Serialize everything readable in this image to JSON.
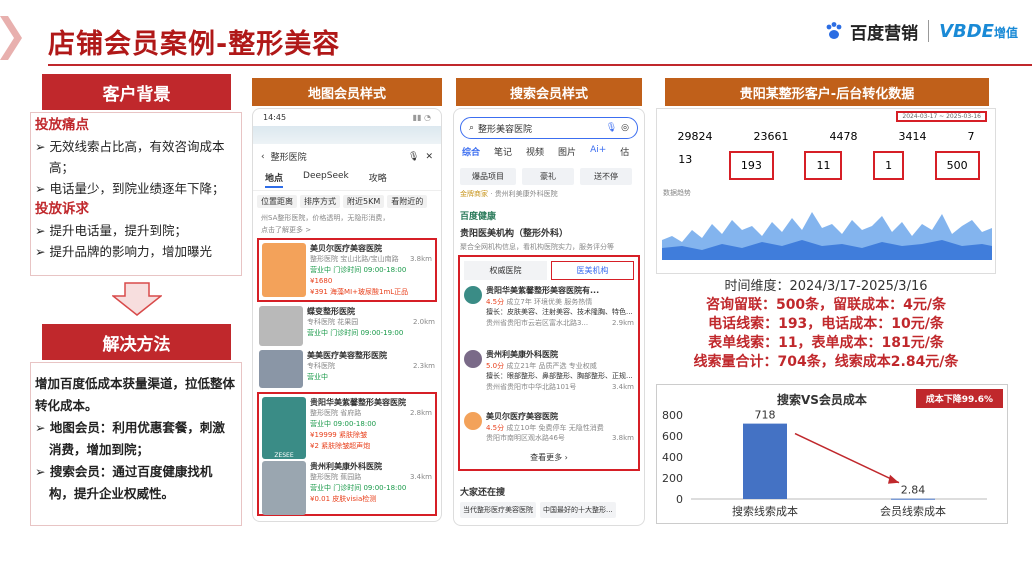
{
  "title": "店铺会员案例-整形美容",
  "logo": {
    "baidu": "百度营销",
    "vbde": "增值"
  },
  "background": {
    "head": "客户背景",
    "pain_title": "投放痛点",
    "pain": [
      "无效线索占比高，有效咨询成本高；",
      "电话量少，到院业绩逐年下降；"
    ],
    "need_title": "投放诉求",
    "need": [
      "提升电话量，提升到院；",
      "提升品牌的影响力，增加曝光"
    ]
  },
  "solution": {
    "head": "解决方法",
    "intro": "增加百度低成本获量渠道，拉低整体转化成本。",
    "items": [
      "地图会员：利用优惠套餐，刺激消费，增加到院；",
      "搜索会员：通过百度健康找机构，提升企业权威性。"
    ]
  },
  "map": {
    "head": "地图会员样式",
    "time": "14:45",
    "search": "整形医院",
    "tabs": [
      "地点",
      "DeepSeek",
      "攻略"
    ],
    "filters": [
      "位置距离",
      "排序方式",
      "附近5KM",
      "看附近的"
    ],
    "top_note": "州SA整形医院，价格透明，无隐形消费，",
    "top_note2": "点击了解更多 >",
    "listings": [
      {
        "name": "美贝尔医疗美容医院",
        "sub": "整形医院 宝山北路/宝山南路",
        "dist": "3.8km",
        "tag": "营业中 门诊时间 09:00-18:00",
        "p1": "¥1680",
        "p2": "¥391 海藻MI+玻尿酸1mL正品"
      },
      {
        "name": "蝶变整形医院",
        "sub": "专科医院 花果园",
        "dist": "2.0km",
        "tag": "营业中 门诊时间 09:00-19:00"
      },
      {
        "name": "美美医疗美容整形医院",
        "sub": "专科医院",
        "dist": "2.3km",
        "tag": "营业中"
      },
      {
        "name": "贵阳华美紫馨整形美容医院",
        "sub": "整形医院 省府路",
        "dist": "2.8km",
        "tag": "营业中 09:00-18:00",
        "p1": "¥19999 紧肤除皱",
        "p2": "¥2 紧肤除皱超声炮"
      },
      {
        "name": "贵州利美康外科医院",
        "sub": "整形医院 蕉园路",
        "dist": "3.4km",
        "tag": "营业中 门诊时间 09:00-18:00",
        "p1": "¥0.01 皮肤visia检测"
      }
    ]
  },
  "search": {
    "head": "搜索会员样式",
    "query": "整形美容医院",
    "tabs": [
      "综合",
      "笔记",
      "视频",
      "图片",
      "Ai+",
      "估"
    ],
    "chips": [
      "爆品项目",
      "豪礼",
      "送不停"
    ],
    "ad_tag": "金牌商家",
    "ad_name": "贵州利美康外科医院",
    "jk": "百度健康",
    "section": "贵阳医美机构（整形外科）",
    "section_sub": "聚合全网机构信息，看机构医院实力，服务评分等",
    "btn1": "权威医院",
    "btn2": "医美机构",
    "orgs": [
      {
        "name": "贵阳华美紫馨整形美容医院有...",
        "score": "4.5分",
        "tags": "成立7年 环境优美 服务热情",
        "field": "擅长：皮肤美容、注射美容、技术隆胸、特色...",
        "addr": "贵州省贵阳市云岩区富水北路3...",
        "dist": "2.9km"
      },
      {
        "name": "贵州利美康外科医院",
        "score": "5.0分",
        "tags": "成立21年 品质严选 专业权威",
        "field": "擅长：眼部整形、鼻部整形、胸部整形、正规...",
        "addr": "贵州省贵阳市中华北路101号",
        "dist": "3.4km"
      },
      {
        "name": "美贝尔医疗美容医院",
        "score": "4.5分",
        "tags": "成立10年 免费停车 无隐性消费",
        "field": "",
        "addr": "贵阳市南明区观水路46号",
        "dist": "3.8km"
      }
    ],
    "more": "查看更多",
    "also": "大家还在搜",
    "also_items": [
      "当代整形医疗美容医院",
      "中国最好的十大整形..."
    ]
  },
  "backend": {
    "head": "贵阳某整形客户-后台转化数据",
    "range": "2024-03-17 ~ 2025-03-16",
    "row1": [
      "29824",
      "23661",
      "4478",
      "3414",
      "7"
    ],
    "row2": [
      "13",
      "193",
      "11",
      "1",
      "500"
    ],
    "trend_label": "数据趋势"
  },
  "stats": {
    "period": "时间维度：2024/3/17-2025/3/16",
    "lines": [
      "咨询留联：500条，留联成本：4元/条",
      "电话线索：193，电话成本：10元/条",
      "表单线索：11，表单成本：181元/条",
      "线索量合计：704条，线索成本2.84元/条"
    ]
  },
  "chart_data": {
    "type": "bar",
    "title": "搜索VS会员成本",
    "categories": [
      "搜索线索成本",
      "会员线索成本"
    ],
    "values": [
      718,
      2.84
    ],
    "ylim": [
      0,
      800
    ],
    "yticks": [
      0,
      200,
      400,
      600,
      800
    ],
    "badge": "成本下降99.6%",
    "bar_color": "#4472c4"
  }
}
